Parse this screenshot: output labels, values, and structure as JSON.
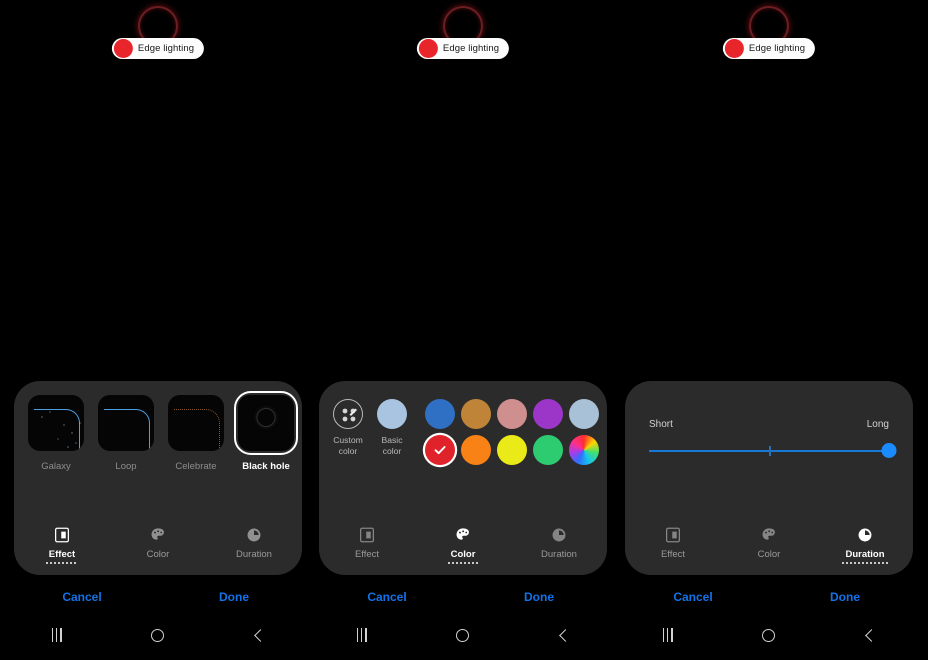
{
  "app": {
    "title": "Edge lighting",
    "notification_label": "Edge lighting",
    "notification_dot_color": "#e8252b",
    "ring_color": "#6b1f22"
  },
  "panels": [
    {
      "id": "effect-panel",
      "active_tab": "Effect",
      "cancel_label": "Cancel",
      "done_label": "Done"
    },
    {
      "id": "color-panel",
      "active_tab": "Color",
      "cancel_label": "Cancel",
      "done_label": "Done"
    },
    {
      "id": "duration-panel",
      "active_tab": "Duration",
      "cancel_label": "Cancel",
      "done_label": "Done"
    }
  ],
  "tabs": {
    "effect_label": "Effect",
    "color_label": "Color",
    "duration_label": "Duration",
    "effect_icon": "effect-icon",
    "color_icon": "palette-icon",
    "duration_icon": "clock-icon"
  },
  "effects": {
    "items": [
      {
        "label": "Galaxy",
        "selected": false,
        "arc_color": "#4f9fe0",
        "style": "sparkle"
      },
      {
        "label": "Loop",
        "selected": false,
        "arc_color": "#4f9fe0",
        "style": "solid"
      },
      {
        "label": "Celebrate",
        "selected": false,
        "arc_color": "#8a5a33",
        "style": "dotted"
      },
      {
        "label": "Black hole",
        "selected": true,
        "arc_color": "#2e2e2e",
        "style": "hole"
      }
    ]
  },
  "colors": {
    "custom_color_label": "Custom\ncolor",
    "custom_color_label_line1": "Custom",
    "custom_color_label_line2": "color",
    "basic_color_label": "Basic color",
    "custom_color_icon": "custom-color-icon",
    "basic_swatch_color": "#a8c4e0",
    "swatches": [
      {
        "name": "blue",
        "color": "#2f6fc4",
        "selected": false
      },
      {
        "name": "bronze",
        "color": "#bf8437",
        "selected": false
      },
      {
        "name": "dusty-pink",
        "color": "#d08f8f",
        "selected": false
      },
      {
        "name": "purple",
        "color": "#9b36c9",
        "selected": false
      },
      {
        "name": "steel-blue",
        "color": "#a9c1d6",
        "selected": false
      },
      {
        "name": "red",
        "color": "#e0232b",
        "selected": true
      },
      {
        "name": "orange",
        "color": "#f98216",
        "selected": false
      },
      {
        "name": "yellow",
        "color": "#eaea18",
        "selected": false
      },
      {
        "name": "green",
        "color": "#2ecc71",
        "selected": false
      },
      {
        "name": "rainbow",
        "color": "rainbow",
        "selected": false
      }
    ]
  },
  "duration": {
    "min_label": "Short",
    "max_label": "Long",
    "value_percent": 100,
    "tick_percent": 50,
    "track_color": "#1878d6",
    "thumb_color": "#1a8cff"
  },
  "navbar": {
    "recents_icon": "recents-icon",
    "home_icon": "home-icon",
    "back_icon": "back-icon"
  }
}
